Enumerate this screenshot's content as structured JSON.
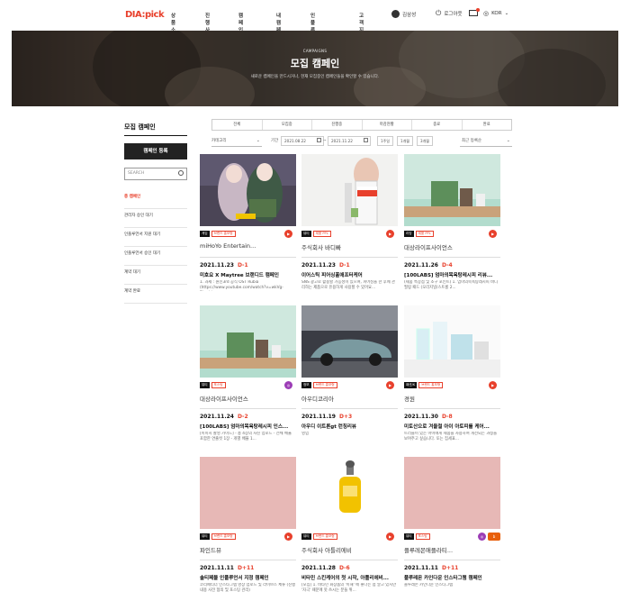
{
  "header": {
    "logo": "DIA:pick",
    "nav": [
      "상품 소개",
      "진행 사례",
      "캠페인 등록",
      "내 캠페인",
      "인플루언서 탐색",
      "고객지원"
    ],
    "user": "김삼성",
    "logout": "로그아웃",
    "lang": "KOR"
  },
  "hero": {
    "sub": "CAMPAIGNS",
    "title": "모집 캠페인",
    "desc": "새로운 캠페인을 만드시거나, 현재 모집중인 캠페인들을 확인할 수 있습니다."
  },
  "sidebar": {
    "title": "모집 캠페인",
    "register": "캠페인 등록",
    "search_placeholder": "SEARCH",
    "items": [
      "총 캠페인",
      "관리자 승인 대기",
      "인플루언서 지원 대기",
      "인플루언서 승인 대기",
      "계약 대기",
      "계약 완료"
    ]
  },
  "tabs": [
    "전체",
    "모집중",
    "진행중",
    "마감현황",
    "종료",
    "완료"
  ],
  "filters": {
    "category": "카테고리",
    "period_label": "기간",
    "date_from": "2021.08.22",
    "tilde": "~",
    "date_to": "2021.11.22",
    "btn_1w": "1주일",
    "btn_1m": "1개월",
    "btn_3m": "3개월",
    "sort": "최근 등록순"
  },
  "cards": [
    {
      "tags": [
        "게임",
        "브랜드 홍보형"
      ],
      "sns": "YT",
      "brand": "miHoYo Entertain...",
      "date": "2021.11.23",
      "dday": "D-1",
      "title": "미호요 X Maytree 브랜디드 캠페인",
      "desc": "1. 과제 : 원신3rd 공식 OST Rubia (https://www.youtube.com/watch?v=wkVg-FLvak)..."
    },
    {
      "tags": [
        "뷰티",
        "제품 PPL"
      ],
      "sns": "YT",
      "brand": "주식회사 바디빠",
      "date": "2021.11.23",
      "dday": "D-1",
      "title": "이어스틱 피어싱홀애프터케어",
      "desc": "SNS 광고로 활용할 가능성이 있으며, 피어싱을 한 후에 관리하는 제품으로 유용하게 사용할 수 있어요..."
    },
    {
      "tags": [
        "리빙",
        "제품 PPL"
      ],
      "sns": "YT",
      "brand": "대상라이프사이언스",
      "date": "2021.11.26",
      "dday": "D-4",
      "title": "[100LABS] 엄마의목욕탕레시피 리뷰...",
      "desc": "(제품 특장점 및 소구 포인트) 1. 엄마의목욕탕레시피 바디 필링 패드 (오리지널/스트롱 2..."
    },
    {
      "tags": [
        "뷰티",
        "포스팅"
      ],
      "sns": "IG",
      "brand": "대상라이프사이언스",
      "date": "2021.11.24",
      "dday": "D-2",
      "title": "[100LABS] 엄마의목욕탕레시피 인스...",
      "desc": "[이미지 촬영 가이드] - 총 4장의 사진 업로드 - 전체 배율 포함한 연출컷 1장 - 개별 배율 1..."
    },
    {
      "tags": [
        "정보",
        "브랜드 홍보형"
      ],
      "sns": "YT",
      "brand": "아우디코리아",
      "date": "2021.11.19",
      "dday": "D+3",
      "title": "아우디 이트론gt 런칭리뷰",
      "desc": "영업"
    },
    {
      "tags": [
        "패션/K",
        "브랜드 홍보형"
      ],
      "sns": "YT",
      "brand": "경원",
      "date": "2021.11.30",
      "dday": "D-8",
      "title": "미토산으로 겨울철 아이 아토피를 케어...",
      "desc": "트러블이 있는 아이에게 제품을 사용하여 개선되는 과정을 보여주고 싶습니다. 또는 집세표..."
    },
    {
      "tags": [
        "뷰티",
        "브랜드 홍보형"
      ],
      "sns": "YT",
      "brand": "파인드뷰",
      "date": "2021.11.11",
      "dday": "D+11",
      "title": "솔티페블 인플루언서 지정 캠페인",
      "desc": "코리페티더 인스타그램 영상 업로드 및 라이브스 체류 (진행 내용 사전 협의 및 포스팅 관리)"
    },
    {
      "tags": [
        "뷰티",
        "브랜드 홍보형"
      ],
      "sns": "YT",
      "brand": "주식회사 아틀리에비",
      "date": "2021.11.28",
      "dday": "D-6",
      "title": "비타민 스킨케어의 첫 시작, 아틀리에비...",
      "desc": "[모집] 1. 비타민 화장품의 '이해' 에 좋다는 점 알고 있지만 '자극' 때문에 못 쓰시는 분들 위..."
    },
    {
      "tags": [
        "뷰티",
        "포스팅"
      ],
      "sns": "IG+BLOG",
      "brand": "플루레몬애플라티...",
      "date": "2021.11.11",
      "dday": "D+11",
      "title": "플루레몬 카인다운 인스타그램 캠페인",
      "desc": "플루레몬 카인다운 인스타그램"
    }
  ]
}
